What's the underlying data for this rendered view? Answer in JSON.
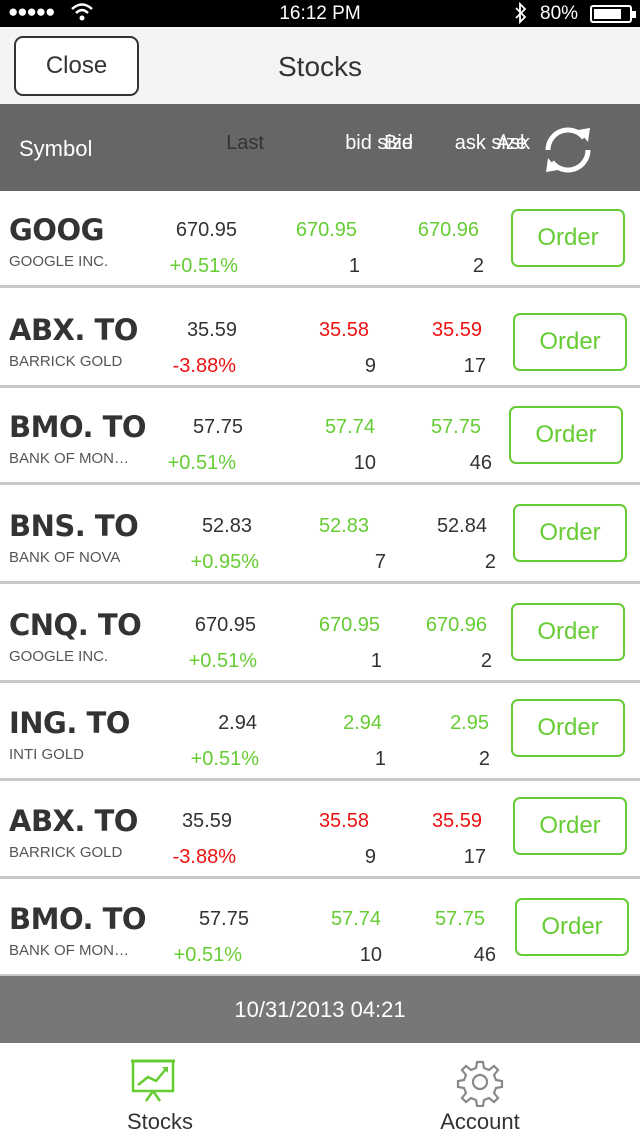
{
  "status": {
    "signal": "●●●●●",
    "time": "16:12 PM",
    "battery": "80%",
    "battery_level": 0.8
  },
  "nav": {
    "close_label": "Close",
    "title": "Stocks"
  },
  "header": {
    "symbol": "Symbol",
    "last": "Last",
    "bid": "Bid",
    "bid_sub": "bid size",
    "ask": "Ask",
    "ask_sub": "ask size"
  },
  "rows": [
    {
      "symbol": "GOOG",
      "name": "GOOGLE INC.",
      "last": "670.95",
      "change": "+0.51%",
      "change_color": "green",
      "bid": "670.95",
      "bid_color": "green",
      "bid_size": "1",
      "ask": "670.96",
      "ask_color": "green",
      "ask_size": "2",
      "order": "Order"
    },
    {
      "symbol": "ABX. TO",
      "name": "BARRICK GOLD",
      "last": "35.59",
      "change": "-3.88%",
      "change_color": "red",
      "bid": "35.58",
      "bid_color": "red",
      "bid_size": "9",
      "ask": "35.59",
      "ask_color": "red",
      "ask_size": "17",
      "order": "Order"
    },
    {
      "symbol": "BMO. TO",
      "name": "BANK OF MON…",
      "last": "57.75",
      "change": "+0.51%",
      "change_color": "green",
      "bid": "57.74",
      "bid_color": "green",
      "bid_size": "10",
      "ask": "57.75",
      "ask_color": "green",
      "ask_size": "46",
      "order": "Order"
    },
    {
      "symbol": "BNS. TO",
      "name": "BANK OF NOVA",
      "last": "52.83",
      "change": "+0.95%",
      "change_color": "green",
      "bid": "52.83",
      "bid_color": "green",
      "bid_size": "7",
      "ask": "52.84",
      "ask_color": "dark",
      "ask_size": "2",
      "order": "Order"
    },
    {
      "symbol": "CNQ. TO",
      "name": "GOOGLE INC.",
      "last": "670.95",
      "change": "+0.51%",
      "change_color": "green",
      "bid": "670.95",
      "bid_color": "green",
      "bid_size": "1",
      "ask": "670.96",
      "ask_color": "green",
      "ask_size": "2",
      "order": "Order"
    },
    {
      "symbol": "ING. TO",
      "name": "INTI GOLD",
      "last": "2.94",
      "change": "+0.51%",
      "change_color": "green",
      "bid": "2.94",
      "bid_color": "green",
      "bid_size": "1",
      "ask": "2.95",
      "ask_color": "green",
      "ask_size": "2",
      "order": "Order"
    },
    {
      "symbol": "ABX. TO",
      "name": "BARRICK GOLD",
      "last": "35.59",
      "change": "-3.88%",
      "change_color": "red",
      "bid": "35.58",
      "bid_color": "red",
      "bid_size": "9",
      "ask": "35.59",
      "ask_color": "red",
      "ask_size": "17",
      "order": "Order"
    },
    {
      "symbol": "BMO. TO",
      "name": "BANK OF MON…",
      "last": "57.75",
      "change": "+0.51%",
      "change_color": "green",
      "bid": "57.74",
      "bid_color": "green",
      "bid_size": "10",
      "ask": "57.75",
      "ask_color": "green",
      "ask_size": "46",
      "order": "Order"
    }
  ],
  "footer": {
    "timestamp": "10/31/2013 04:21"
  },
  "tabs": [
    {
      "label": "Stocks",
      "icon": "chart-icon",
      "active": true
    },
    {
      "label": "Account",
      "icon": "gear-icon",
      "active": false
    }
  ],
  "colors": {
    "green": "#66cc33",
    "red": "#ee1111",
    "header_bg": "#666666",
    "footer_bg": "#777777"
  }
}
